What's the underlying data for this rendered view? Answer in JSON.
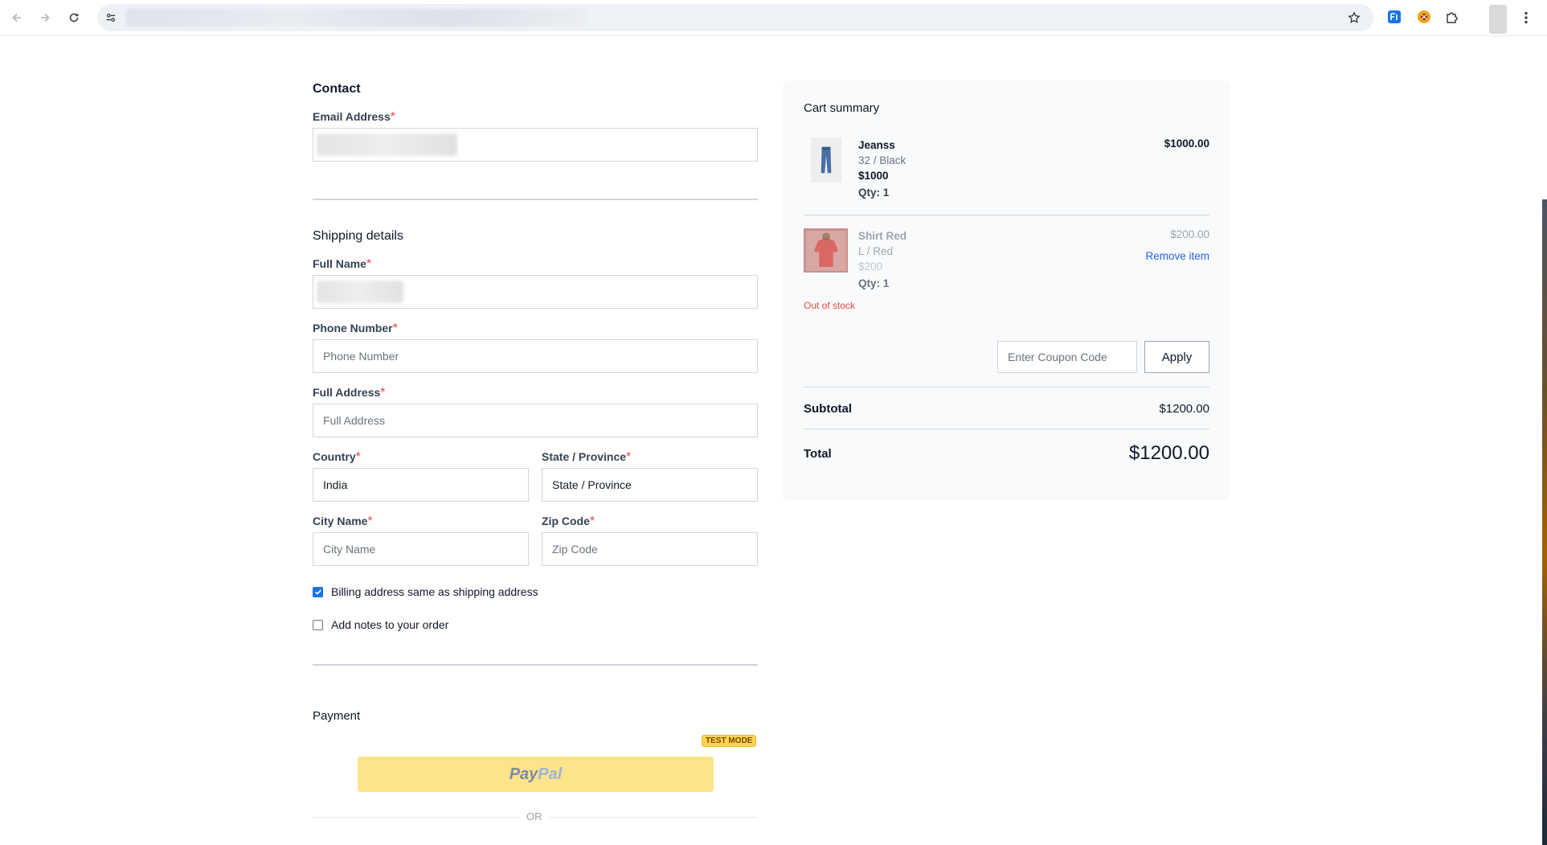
{
  "browser": {
    "icons": [
      "back-arrow-icon",
      "forward-arrow-icon",
      "reload-icon",
      "site-settings-icon",
      "bookmark-star-icon",
      "extension-icon",
      "extension-icon",
      "puzzle-extensions-icon",
      "menu-dots-icon"
    ]
  },
  "contact": {
    "title": "Contact",
    "email_label": "Email Address",
    "required_mark": "*"
  },
  "shipping": {
    "title": "Shipping details",
    "full_name_label": "Full Name",
    "phone_label": "Phone Number",
    "phone_placeholder": "Phone Number",
    "address_label": "Full Address",
    "address_placeholder": "Full Address",
    "country_label": "Country",
    "country_value": "India",
    "state_label": "State / Province",
    "state_value": "State / Province",
    "city_label": "City Name",
    "city_placeholder": "City Name",
    "zip_label": "Zip Code",
    "zip_placeholder": "Zip Code",
    "billing_same_label": "Billing address same as shipping address",
    "billing_same_checked": true,
    "notes_label": "Add notes to your order",
    "notes_checked": false
  },
  "payment": {
    "title": "Payment",
    "test_mode_badge": "TEST MODE",
    "paypal_pay": "Pay",
    "paypal_pal": "Pal",
    "or_text": "OR"
  },
  "cart": {
    "title": "Cart summary",
    "items": [
      {
        "name": "Jeanss",
        "variant": "32 / Black",
        "price": "$1000",
        "qty": "Qty: 1",
        "line_total": "$1000.00",
        "in_stock": true
      },
      {
        "name": "Shirt Red",
        "variant": "L / Red",
        "price": "$200",
        "qty": "Qty: 1",
        "line_total": "$200.00",
        "in_stock": false,
        "remove_label": "Remove item",
        "stock_status": "Out of stock"
      }
    ],
    "coupon_placeholder": "Enter Coupon Code",
    "apply_label": "Apply",
    "subtotal_label": "Subtotal",
    "subtotal_value": "$1200.00",
    "total_label": "Total",
    "total_value": "$1200.00"
  },
  "colors": {
    "required": "#ef4444",
    "link": "#2563eb",
    "paypal_button": "#fde38a",
    "checkbox_checked": "#1a73e8"
  }
}
